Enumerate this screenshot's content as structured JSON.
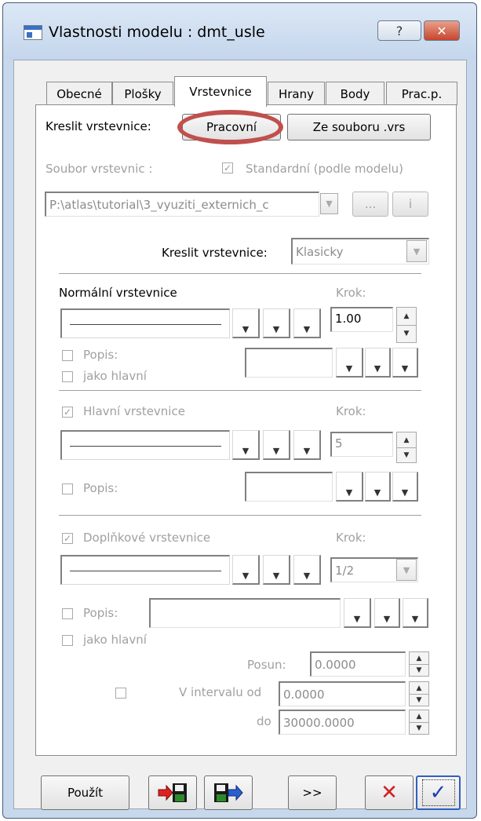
{
  "window": {
    "title": "Vlastnosti modelu : dmt_usle",
    "help_label": "?",
    "close_label": "✕"
  },
  "tabs": [
    {
      "label": "Obecné"
    },
    {
      "label": "Plošky"
    },
    {
      "label": "Vrstevnice",
      "active": true
    },
    {
      "label": "Hrany"
    },
    {
      "label": "Body"
    },
    {
      "label": "Prac.p."
    }
  ],
  "draw": {
    "label": "Kreslit vrstevnice:",
    "btn_work": "Pracovní",
    "btn_file": "Ze souboru .vrs"
  },
  "file": {
    "label": "Soubor vrstevnic :",
    "standard_label": "Standardní (podle modelu)",
    "path": "P:\\atlas\\tutorial\\3_vyuziti_externich_c",
    "browse_label": "...",
    "info_label": "i"
  },
  "style": {
    "label": "Kreslit vrstevnice:",
    "value": "Klasicky"
  },
  "normal": {
    "title": "Normální vrstevnice",
    "step_label": "Krok:",
    "step_value": "1.00",
    "desc_label": "Popis:",
    "as_main_label": "jako hlavní"
  },
  "main": {
    "title": "Hlavní vrstevnice",
    "step_label": "Krok:",
    "step_value": "5",
    "desc_label": "Popis:"
  },
  "extra": {
    "title": "Doplňkové vrstevnice",
    "step_label": "Krok:",
    "step_value": "1/2",
    "desc_label": "Popis:",
    "as_main_label": "jako hlavní",
    "shift_label": "Posun:",
    "shift_value": "0.0000",
    "interval_label": "V intervalu od",
    "from_value": "0.0000",
    "to_label": "do",
    "to_value": "30000.0000"
  },
  "footer": {
    "apply_label": "Použít",
    "more_label": ">>",
    "cancel_label": "✕",
    "ok_label": "✓"
  },
  "colors": {
    "highlight": "#c0504d",
    "cancel": "#d02020",
    "ok": "#1a3fb0"
  }
}
